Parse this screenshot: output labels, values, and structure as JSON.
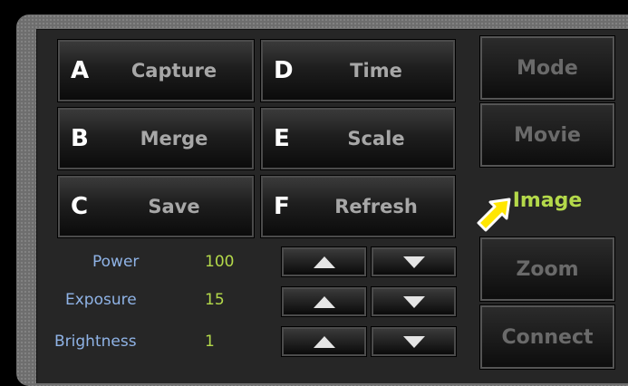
{
  "buttons": {
    "capture": {
      "letter": "A",
      "label": "Capture"
    },
    "merge": {
      "letter": "B",
      "label": "Merge"
    },
    "save": {
      "letter": "C",
      "label": "Save"
    },
    "time": {
      "letter": "D",
      "label": "Time"
    },
    "scale": {
      "letter": "E",
      "label": "Scale"
    },
    "refresh": {
      "letter": "F",
      "label": "Refresh"
    }
  },
  "modes": [
    {
      "label": "Mode",
      "active": false
    },
    {
      "label": "Movie",
      "active": false
    },
    {
      "label": "Image",
      "active": true
    },
    {
      "label": "Zoom",
      "active": false
    },
    {
      "label": "Connect",
      "active": false
    }
  ],
  "settings": [
    {
      "label": "Power",
      "value": "100"
    },
    {
      "label": "Exposure",
      "value": "15"
    },
    {
      "label": "Brightness",
      "value": "1"
    }
  ],
  "colors": {
    "accent": "#b4d94a",
    "label_blue": "#8fb3e6",
    "pointer": "#ffe600"
  },
  "icons": {
    "up": "up-arrow-icon",
    "down": "down-arrow-icon",
    "pointer": "yellow-arrow-pointer-icon"
  }
}
